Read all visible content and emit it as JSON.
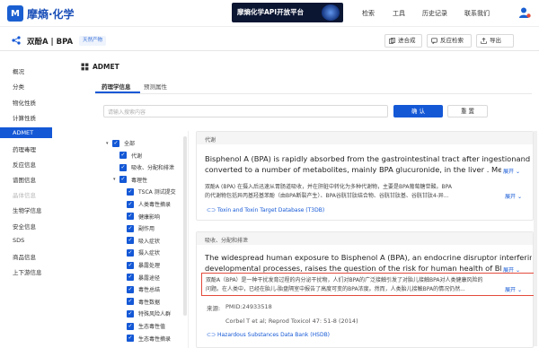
{
  "header": {
    "logo_text": "摩熵·化学",
    "logo_mark": "M",
    "banner_text": "摩熵化学API开放平台",
    "nav": [
      "检索",
      "工具",
      "历史记录",
      "联系我们"
    ]
  },
  "compound": {
    "title": "双酚A | BPA",
    "tag": "天然产物"
  },
  "toolbar": {
    "compare": "进合成",
    "feedback": "反应检索",
    "export": "导出"
  },
  "sidebar": {
    "items": [
      "概况",
      "分类",
      "物化性质",
      "计算性质",
      "ADMET",
      "药理毒理",
      "反应信息",
      "谱图信息",
      "晶体信息",
      "生物学信息",
      "安全信息",
      "SDS",
      "商品信息",
      "上下游信息"
    ],
    "active_index": 4,
    "disabled_index": 8
  },
  "section": {
    "title": "ADMET",
    "tabs": [
      "药理学信息",
      "预测属性"
    ],
    "active_tab": 0
  },
  "search": {
    "placeholder": "请输入搜索内容",
    "confirm": "确 认",
    "reset": "重 置"
  },
  "tree": [
    {
      "label": "全部",
      "level": 0,
      "expander": "▾"
    },
    {
      "label": "代谢",
      "level": 1,
      "expander": ""
    },
    {
      "label": "吸收、分配和排泄",
      "level": 1,
      "expander": ""
    },
    {
      "label": "毒理性",
      "level": 1,
      "expander": "▾"
    },
    {
      "label": "TSCA 测试提交",
      "level": 2,
      "expander": ""
    },
    {
      "label": "人类毒性摘录",
      "level": 2,
      "expander": ""
    },
    {
      "label": "健康影响",
      "level": 2,
      "expander": ""
    },
    {
      "label": "副作用",
      "level": 2,
      "expander": ""
    },
    {
      "label": "吸入症状",
      "level": 2,
      "expander": ""
    },
    {
      "label": "摄入症状",
      "level": 2,
      "expander": ""
    },
    {
      "label": "暴露处理",
      "level": 2,
      "expander": ""
    },
    {
      "label": "暴露途径",
      "level": 2,
      "expander": ""
    },
    {
      "label": "毒性总结",
      "level": 2,
      "expander": ""
    },
    {
      "label": "毒性数据",
      "level": 2,
      "expander": ""
    },
    {
      "label": "特殊风险人群",
      "level": 2,
      "expander": ""
    },
    {
      "label": "生态毒性值",
      "level": 2,
      "expander": ""
    },
    {
      "label": "生态毒性摘录",
      "level": 2,
      "expander": ""
    }
  ],
  "cards": {
    "metabolism": {
      "heading": "代谢",
      "en_line1": "Bisphenol A (BPA) is rapidly absorbed from the gastrointestinal tract after ingestionand is then",
      "en_line2": "converted to a number of metabolites, mainly BPA glucuronide, in the liver . Metabolit...",
      "expand1": "展开",
      "zh_line1": "双酚A (BPA) 在摄入后迅速从胃肠道吸收，并在肝脏中转化为多种代谢物，主要是BPA葡萄糖苷酸。BPA",
      "zh_line2": "的代谢物包括异丙基羟基苯酚（由BPA断裂产生）、BPA谷胱甘肽结合物、谷胱甘肽基、谷胱甘肽4-异...",
      "expand2": "展开",
      "source": "Toxin and Toxin Target Database (T3DB)"
    },
    "absorption": {
      "heading": "吸收、分配和排泄",
      "en_line1": "The widespread human exposure to Bisphenol A (BPA), an endocrine disruptor interfering with",
      "en_line2": "developmental processes, raises the question of the risk for human health of BPA fetal ...",
      "expand1": "展开",
      "zh_line1": "双酚A（BPA）是一种干扰发育过程的内分泌干扰物，人们对BPA的广泛接触引发了对胎儿接触BPA对人类健康风险的",
      "zh_line2": "问题。在人类中，已经在胎儿-胎盘隔室中报告了高度可变的BPA浓度。然而，人类胎儿接触BPA的情况仍然...",
      "expand2": "展开",
      "source_label": "来源:",
      "pmid": "PMID:24933518",
      "citation": "Corbel T et al; Reprod Toxicol 47: 51-8 (2014)",
      "source": "Hazardous Substances Data Bank (HSDB)"
    }
  },
  "colors": {
    "primary": "#1458d6",
    "highlight_border": "#e34b3b"
  }
}
